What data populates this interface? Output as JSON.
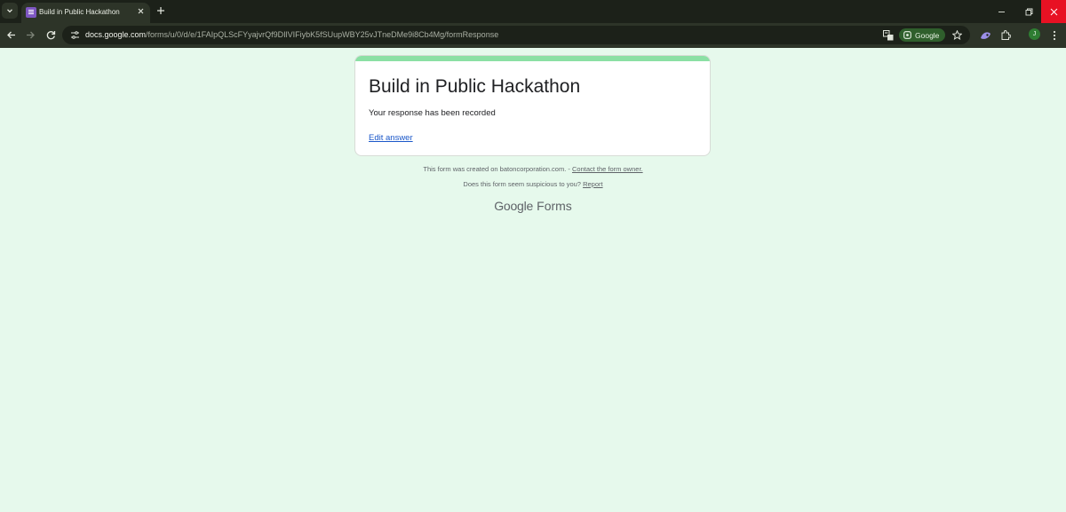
{
  "browser": {
    "tab": {
      "title": "Build in Public Hackathon"
    },
    "address": {
      "host": "docs.google.com",
      "path": "/forms/u/0/d/e/1FAIpQLScFYyajvrQf9DIlVIFiybK5fSUupWBY25vJTneDMe9i8Cb4Mg/formResponse"
    },
    "google_chip_label": "Google",
    "avatar_letter": "J"
  },
  "form": {
    "title": "Build in Public Hackathon",
    "confirmation": "Your response has been recorded",
    "edit_answer_label": "Edit answer"
  },
  "footer": {
    "created_text": "This form was created on batoncorporation.com. -",
    "contact_link": "Contact the form owner.",
    "suspicious_text": "Does this form seem suspicious to you?",
    "report_link": "Report"
  },
  "logo": {
    "brand": "Google",
    "product": "Forms"
  },
  "colors": {
    "page_background": "#e6f9ec",
    "card_accent": "#8be0a4",
    "link": "#1a57c9",
    "chrome_dark": "#1c2119",
    "chrome_toolbar": "#2d3428",
    "close_red": "#e81123"
  },
  "icons": [
    "tab-search-icon",
    "forms-favicon-icon",
    "close-icon",
    "plus-icon",
    "minimize-icon",
    "restore-icon",
    "window-close-icon",
    "back-arrow-icon",
    "forward-arrow-icon",
    "reload-icon",
    "site-settings-icon",
    "translate-icon",
    "google-lens-icon",
    "star-icon",
    "gemini-icon",
    "extensions-icon",
    "more-icon"
  ]
}
